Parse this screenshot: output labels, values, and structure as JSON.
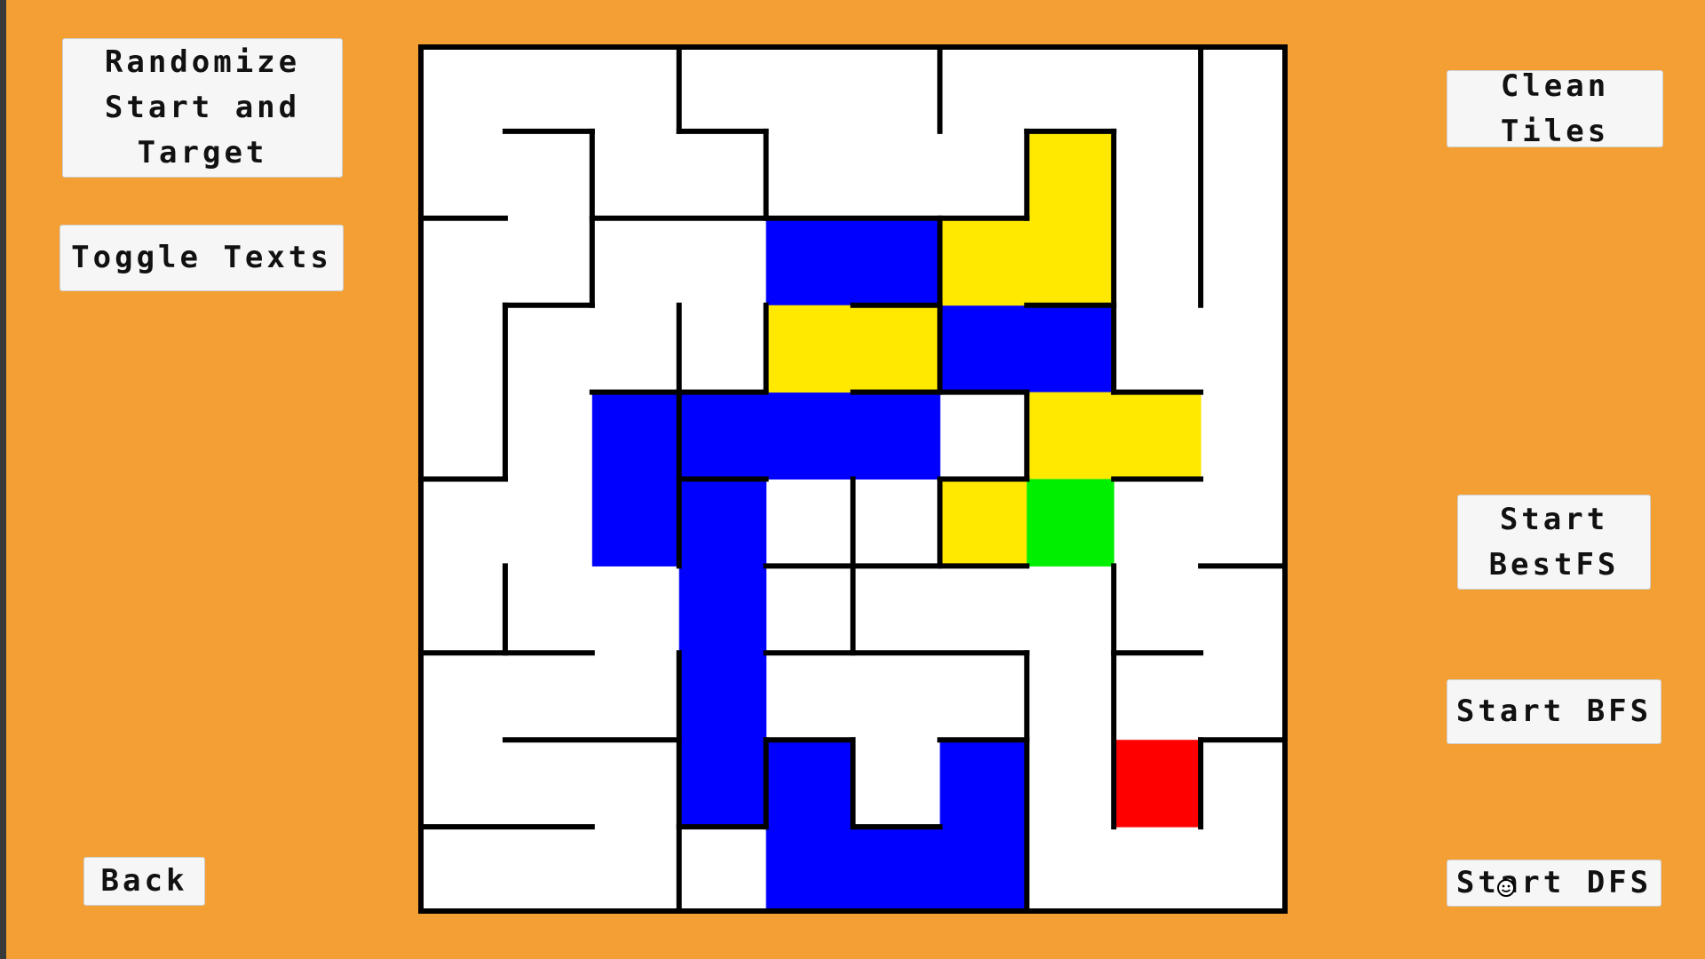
{
  "buttons": {
    "randomize": "Randomize Start and Target",
    "toggle_texts": "Toggle Texts",
    "back": "Back",
    "clean_tiles": "Clean Tiles",
    "start_bestfs": "Start BestFS",
    "start_bfs": "Start BFS",
    "start_dfs": "Start DFS"
  },
  "colors": {
    "background": "#f49f33",
    "floor": "#ffffff",
    "wall": "#000000",
    "visited": "#0000ff",
    "path": "#ffe900",
    "start": "#00ee00",
    "target": "#ff0000"
  },
  "maze": {
    "rows": 10,
    "cols": 10,
    "visited_cells": [
      [
        2,
        4
      ],
      [
        2,
        5
      ],
      [
        3,
        6
      ],
      [
        3,
        7
      ],
      [
        4,
        2
      ],
      [
        4,
        3
      ],
      [
        4,
        4
      ],
      [
        4,
        5
      ],
      [
        5,
        2
      ],
      [
        5,
        3
      ],
      [
        6,
        3
      ],
      [
        7,
        3
      ],
      [
        8,
        3
      ],
      [
        8,
        4
      ],
      [
        8,
        6
      ],
      [
        9,
        4
      ],
      [
        9,
        5
      ],
      [
        9,
        6
      ]
    ],
    "path_cells": [
      [
        1,
        7
      ],
      [
        2,
        6
      ],
      [
        2,
        7
      ],
      [
        3,
        4
      ],
      [
        3,
        5
      ],
      [
        4,
        7
      ],
      [
        4,
        8
      ],
      [
        5,
        6
      ]
    ],
    "start_cell": [
      5,
      7
    ],
    "target_cell": [
      8,
      8
    ],
    "walls_h": [
      [
        1,
        1,
        2
      ],
      [
        1,
        3,
        4
      ],
      [
        1,
        5,
        6
      ],
      [
        1,
        7,
        8
      ],
      [
        2,
        0,
        1
      ],
      [
        2,
        2,
        5
      ],
      [
        2,
        5,
        7
      ],
      [
        3,
        1,
        2
      ],
      [
        4,
        2,
        4
      ],
      [
        4,
        5,
        8
      ],
      [
        4,
        8,
        9
      ],
      [
        5,
        1,
        2
      ],
      [
        5,
        3,
        5
      ],
      [
        5,
        6,
        7
      ],
      [
        5,
        8,
        9
      ],
      [
        6,
        2,
        3
      ],
      [
        6,
        5,
        8
      ],
      [
        6,
        9,
        10
      ],
      [
        7,
        0,
        2
      ],
      [
        7,
        4,
        7
      ],
      [
        7,
        8,
        9
      ],
      [
        8,
        1,
        3
      ],
      [
        8,
        4,
        5
      ],
      [
        8,
        6,
        7
      ],
      [
        8,
        9,
        10
      ],
      [
        9,
        0,
        2
      ],
      [
        9,
        3,
        4
      ],
      [
        9,
        5,
        6
      ]
    ],
    "walls_v": [
      [
        1,
        1,
        3
      ],
      [
        2,
        0,
        1
      ],
      [
        2,
        3,
        6
      ],
      [
        3,
        1,
        2
      ],
      [
        4,
        0,
        1
      ],
      [
        5,
        3,
        4
      ],
      [
        6,
        0,
        2
      ],
      [
        7,
        1,
        3
      ],
      [
        9,
        0,
        4
      ],
      [
        1,
        6,
        7
      ],
      [
        1,
        10,
        11
      ],
      [
        3,
        9,
        11
      ],
      [
        4,
        3,
        5
      ],
      [
        4,
        8,
        12
      ],
      [
        5,
        13,
        14
      ],
      [
        6,
        8,
        10
      ],
      [
        7,
        7,
        11
      ],
      [
        8,
        4,
        5
      ],
      [
        9,
        2,
        3
      ],
      [
        9,
        7,
        9
      ],
      [
        10,
        2,
        5
      ],
      [
        10,
        8,
        9
      ],
      [
        10,
        11,
        12
      ],
      [
        12,
        6,
        8
      ],
      [
        12,
        10,
        11
      ],
      [
        13,
        3,
        5
      ],
      [
        13,
        13,
        14
      ],
      [
        2,
        14,
        17
      ],
      [
        2,
        19,
        21
      ],
      [
        3,
        15,
        16
      ],
      [
        4,
        14,
        18
      ],
      [
        4,
        20,
        22
      ],
      [
        6,
        14,
        18
      ],
      [
        7,
        14,
        20
      ],
      [
        8,
        14,
        17
      ],
      [
        9,
        14,
        15
      ],
      [
        9,
        17,
        20
      ],
      [
        10,
        13,
        14
      ],
      [
        10,
        16,
        17
      ],
      [
        10,
        18,
        19
      ],
      [
        10,
        20,
        21
      ],
      [
        11,
        14,
        15
      ],
      [
        12,
        17,
        20
      ],
      [
        13,
        19,
        21
      ],
      [
        14,
        14,
        15
      ],
      [
        14,
        18,
        20
      ],
      [
        1,
        21,
        24
      ],
      [
        1,
        26,
        29
      ],
      [
        2,
        24,
        25
      ],
      [
        2,
        28,
        30
      ],
      [
        3,
        22,
        23
      ],
      [
        4,
        25,
        26
      ],
      [
        5,
        22,
        24
      ],
      [
        5,
        27,
        30
      ],
      [
        6,
        22,
        23
      ],
      [
        6,
        25,
        27
      ],
      [
        8,
        22,
        23
      ],
      [
        8,
        24,
        28
      ],
      [
        9,
        21,
        22
      ],
      [
        9,
        27,
        29
      ],
      [
        10,
        23,
        25
      ],
      [
        10,
        28,
        30
      ],
      [
        11,
        21,
        23
      ],
      [
        12,
        26,
        30
      ],
      [
        13,
        25,
        28
      ],
      [
        14,
        22,
        24
      ],
      [
        14,
        27,
        29
      ],
      [
        1,
        31,
        35
      ],
      [
        2,
        33,
        37
      ],
      [
        3,
        31,
        33
      ],
      [
        4,
        36,
        37
      ],
      [
        5,
        31,
        34
      ],
      [
        6,
        34,
        36
      ],
      [
        7,
        33,
        35
      ],
      [
        8,
        31,
        33
      ],
      [
        8,
        35,
        38
      ],
      [
        9,
        34,
        35
      ],
      [
        10,
        31,
        32
      ],
      [
        10,
        33,
        38
      ],
      [
        11,
        32,
        34
      ],
      [
        12,
        35,
        37
      ],
      [
        13,
        31,
        33
      ],
      [
        13,
        34,
        36
      ],
      [
        2,
        39,
        44
      ],
      [
        3,
        40,
        42
      ],
      [
        4,
        43,
        44
      ],
      [
        5,
        39,
        40
      ],
      [
        6,
        41,
        43
      ],
      [
        7,
        39,
        41
      ],
      [
        8,
        42,
        44
      ],
      [
        9,
        40,
        42
      ],
      [
        10,
        39,
        40
      ],
      [
        11,
        41,
        44
      ],
      [
        12,
        39,
        42
      ],
      [
        13,
        40,
        43
      ],
      [
        14,
        41,
        42
      ],
      [
        1,
        45,
        48
      ],
      [
        2,
        46,
        47
      ],
      [
        3,
        45,
        46
      ],
      [
        4,
        47,
        49
      ],
      [
        5,
        45,
        46
      ],
      [
        6,
        46,
        48
      ],
      [
        7,
        45,
        46
      ],
      [
        8,
        45,
        47
      ],
      [
        9,
        46,
        48
      ],
      [
        10,
        45,
        47
      ],
      [
        11,
        46,
        48
      ],
      [
        12,
        45,
        48
      ],
      [
        13,
        46,
        47
      ],
      [
        14,
        45,
        48
      ]
    ],
    "walls_v2": [
      [
        1,
        0,
        2
      ],
      [
        2,
        1,
        3
      ],
      [
        3,
        0,
        1
      ],
      [
        5,
        1,
        2
      ],
      [
        4,
        3,
        4
      ],
      [
        6,
        3,
        5
      ],
      [
        7,
        1,
        3
      ],
      [
        2,
        3,
        5
      ],
      [
        7,
        4,
        6
      ],
      [
        8,
        2,
        3
      ],
      [
        3,
        6,
        9
      ],
      [
        5,
        5,
        6
      ],
      [
        6,
        6,
        7
      ],
      [
        7,
        7,
        8
      ],
      [
        4,
        7,
        8
      ],
      [
        9,
        0,
        2
      ],
      [
        8,
        5,
        8
      ],
      [
        9,
        6,
        8
      ],
      [
        4,
        9,
        10
      ],
      [
        5,
        8,
        10
      ],
      [
        1,
        4,
        6
      ],
      [
        1,
        8,
        9
      ]
    ]
  }
}
